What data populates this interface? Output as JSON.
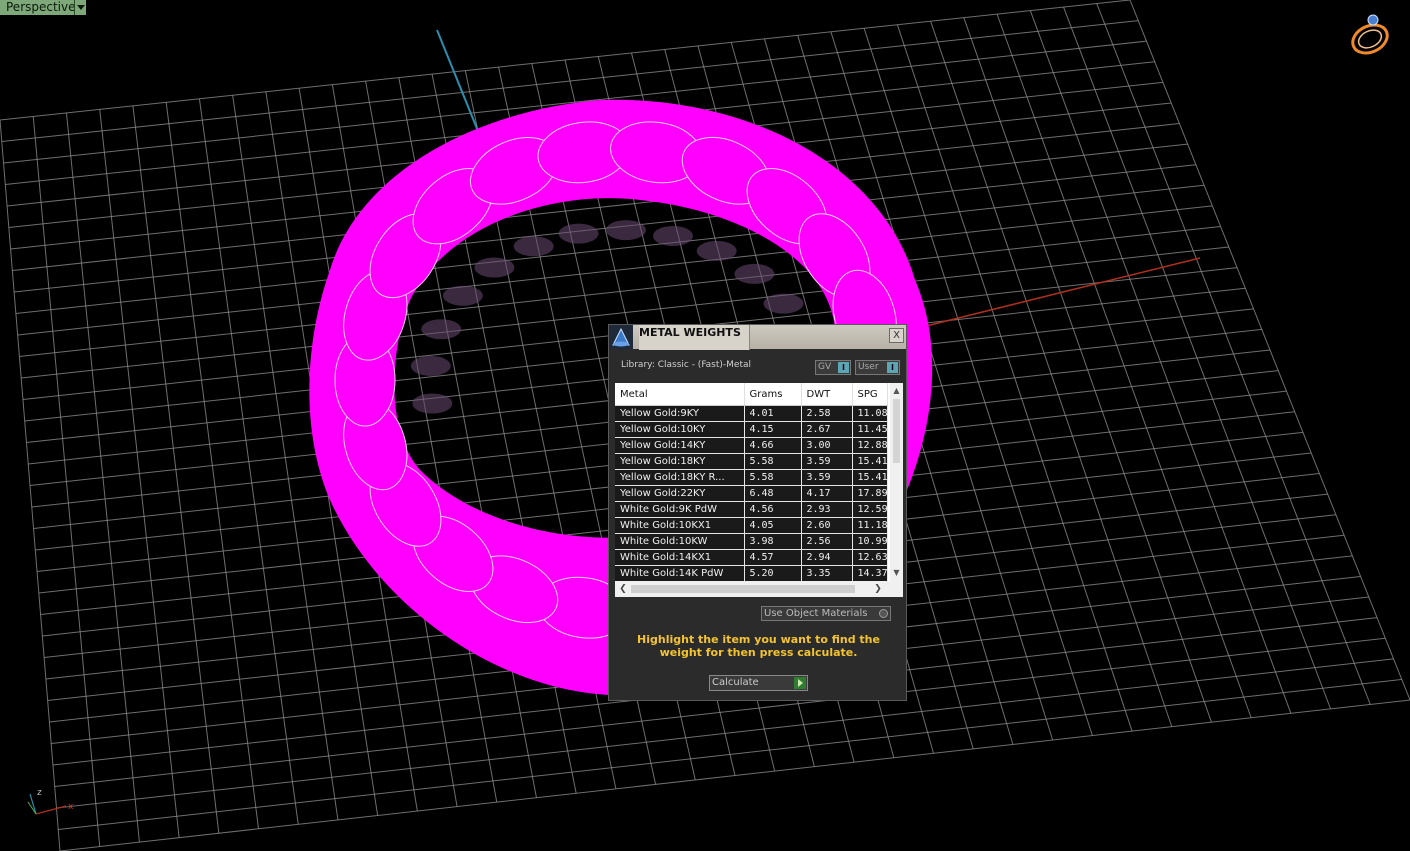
{
  "viewport": {
    "label": "Perspective",
    "axis_x": "x",
    "axis_z": "z"
  },
  "dialog": {
    "title": "METAL WEIGHTS",
    "close": "X",
    "library": "Library: Classic - (Fast)-Metal",
    "toggle_gv": "GV",
    "toggle_user": "User",
    "toggle_knob": "I",
    "columns": [
      "Metal",
      "Grams",
      "DWT",
      "SPG"
    ],
    "rows": [
      [
        "Yellow Gold:9KY",
        "4.01",
        "2.58",
        "11.08"
      ],
      [
        "Yellow Gold:10KY",
        "4.15",
        "2.67",
        "11.45"
      ],
      [
        "Yellow Gold:14KY",
        "4.66",
        "3.00",
        "12.88"
      ],
      [
        "Yellow Gold:18KY",
        "5.58",
        "3.59",
        "15.41"
      ],
      [
        "Yellow Gold:18KY R...",
        "5.58",
        "3.59",
        "15.41"
      ],
      [
        "Yellow Gold:22KY",
        "6.48",
        "4.17",
        "17.89"
      ],
      [
        "White Gold:9K PdW",
        "4.56",
        "2.93",
        "12.59"
      ],
      [
        "White Gold:10KX1",
        "4.05",
        "2.60",
        "11.18"
      ],
      [
        "White Gold:10KW",
        "3.98",
        "2.56",
        "10.99"
      ],
      [
        "White Gold:14KX1",
        "4.57",
        "2.94",
        "12.63"
      ],
      [
        "White Gold:14K PdW",
        "5.20",
        "3.35",
        "14.37"
      ]
    ],
    "use_object_materials": "Use Object Materials",
    "hint": "Highlight the item you want to find the weight for then press calculate.",
    "calculate": "Calculate"
  },
  "colors": {
    "ring": "#ff00ff",
    "grid": "#8a8a8a",
    "axis_x": "#b03020",
    "axis_y": "#2b8fb0",
    "hint": "#f4c430",
    "viewport_label_bg": "#7fa87a"
  }
}
